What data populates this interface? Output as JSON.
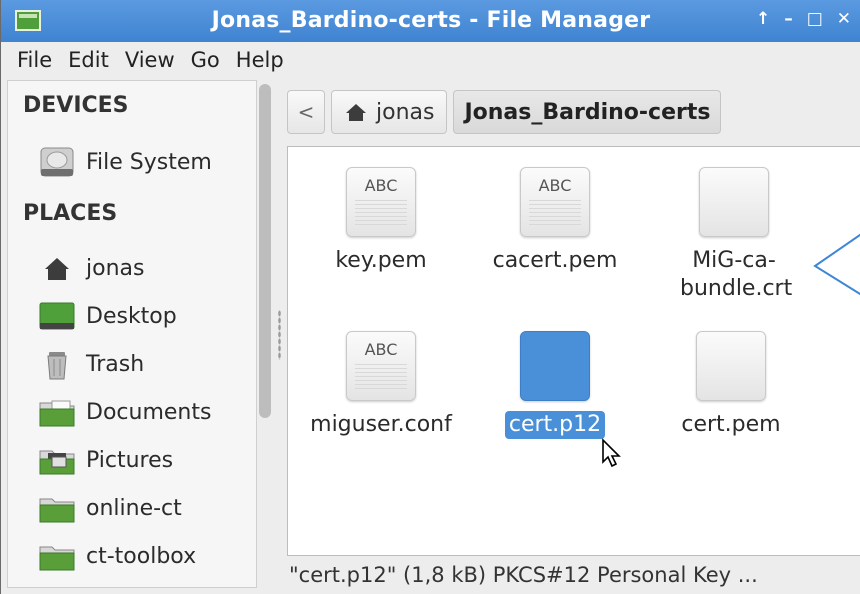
{
  "window": {
    "title": "Jonas_Bardino-certs - File Manager",
    "controls": [
      "↑",
      "–",
      "□",
      "✕"
    ]
  },
  "menu": [
    "File",
    "Edit",
    "View",
    "Go",
    "Help"
  ],
  "sidebar": {
    "devices_heading": "DEVICES",
    "devices": [
      {
        "label": "File System",
        "icon": "harddisk-icon"
      }
    ],
    "places_heading": "PLACES",
    "places": [
      {
        "label": "jonas",
        "icon": "home-icon"
      },
      {
        "label": "Desktop",
        "icon": "desktop-icon"
      },
      {
        "label": "Trash",
        "icon": "trash-icon"
      },
      {
        "label": "Documents",
        "icon": "folder-icon"
      },
      {
        "label": "Pictures",
        "icon": "pictures-folder-icon"
      },
      {
        "label": "online-ct",
        "icon": "folder-icon"
      },
      {
        "label": "ct-toolbox",
        "icon": "folder-icon"
      }
    ]
  },
  "pathbar": {
    "back": "<",
    "home": "jonas",
    "current": "Jonas_Bardino-certs"
  },
  "files": [
    {
      "name": "key.pem",
      "icon": "text-file-icon",
      "label": "ABC"
    },
    {
      "name": "cacert.pem",
      "icon": "text-file-icon",
      "label": "ABC"
    },
    {
      "name": "MiG-ca-bundle.crt",
      "icon": "blank-file-icon",
      "label": ""
    },
    {
      "name": "miguser.conf",
      "icon": "text-file-icon",
      "label": "ABC"
    },
    {
      "name": "cert.p12",
      "icon": "selected-file-icon",
      "label": "",
      "selected": true
    },
    {
      "name": "cert.pem",
      "icon": "blank-file-icon",
      "label": ""
    }
  ],
  "status": "\"cert.p12\" (1,8 kB) PKCS#12 Personal Key ...",
  "colors": {
    "titlebar": "#4a8cd8",
    "selection": "#4a90d9",
    "folder": "#5a9e3a"
  }
}
